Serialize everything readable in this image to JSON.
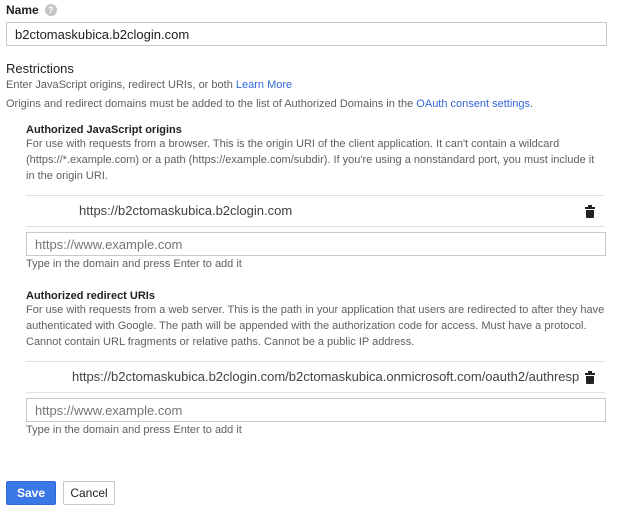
{
  "name": {
    "label": "Name",
    "help_icon": "question-circle-icon",
    "value": "b2ctomaskubica.b2clogin.com"
  },
  "restrictions": {
    "title": "Restrictions",
    "desc_prefix": "Enter JavaScript origins, redirect URIs, or both",
    "learn_more": "Learn More",
    "note_prefix": "Origins and redirect domains must be added to the list of Authorized Domains in the",
    "oauth_link": "OAuth consent settings",
    "note_suffix": "."
  },
  "js_origins": {
    "title": "Authorized JavaScript origins",
    "desc_line1": "For use with requests from a browser. This is the origin URI of the client application. It can't contain a wildcard",
    "desc_line2": "(https://*.example.com) or a path (https://example.com/subdir). If you're using a nonstandard port, you must include it",
    "desc_line3": "in the origin URI.",
    "entries": [
      "https://b2ctomaskubica.b2clogin.com"
    ],
    "delete_icon": "trash-icon",
    "input_placeholder": "https://www.example.com",
    "input_value": "",
    "hint": "Type in the domain and press Enter to add it"
  },
  "redirect_uris": {
    "title": "Authorized redirect URIs",
    "desc_line1": "For use with requests from a web server. This is the path in your application that users are redirected to after they have",
    "desc_line2": "authenticated with Google. The path will be appended with the authorization code for access. Must have a protocol.",
    "desc_line3": "Cannot contain URL fragments or relative paths. Cannot be a public IP address.",
    "entries": [
      "https://b2ctomaskubica.b2clogin.com/b2ctomaskubica.onmicrosoft.com/oauth2/authresp"
    ],
    "delete_icon": "trash-icon",
    "input_placeholder": "https://www.example.com",
    "input_value": "",
    "hint": "Type in the domain and press Enter to add it"
  },
  "actions": {
    "save_label": "Save",
    "cancel_label": "Cancel",
    "save_color": "#3b78e7",
    "link_color": "#3367d6"
  }
}
